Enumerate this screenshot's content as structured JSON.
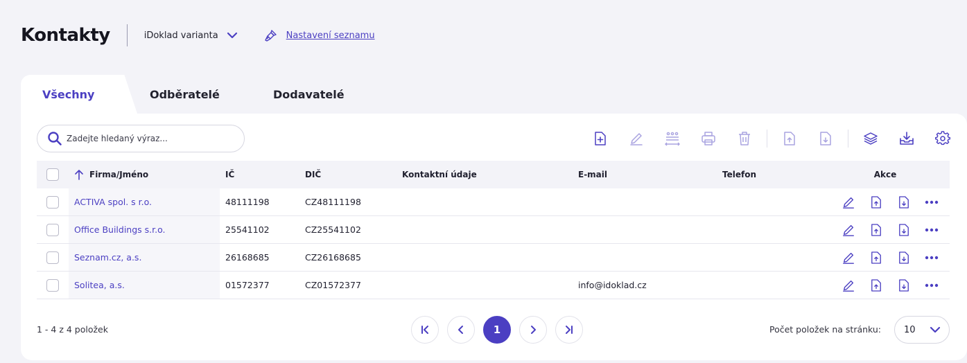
{
  "header": {
    "title": "Kontakty",
    "variant_label": "iDoklad varianta",
    "settings_link": "Nastavení seznamu"
  },
  "tabs": [
    {
      "label": "Všechny",
      "active": true
    },
    {
      "label": "Odběratelé",
      "active": false
    },
    {
      "label": "Dodavatelé",
      "active": false
    }
  ],
  "search": {
    "placeholder": "Zadejte hledaný výraz..."
  },
  "toolbar": {
    "icons": [
      "new-document-icon",
      "edit-icon",
      "bulk-action-icon",
      "print-icon",
      "delete-icon",
      "export-icon",
      "import-icon",
      "layers-icon",
      "download-icon",
      "settings-icon"
    ]
  },
  "table": {
    "columns": {
      "name": "Firma/Jméno",
      "ic": "IČ",
      "dic": "DIČ",
      "contact": "Kontaktní údaje",
      "email": "E-mail",
      "phone": "Telefon",
      "actions": "Akce"
    },
    "rows": [
      {
        "name": "ACTIVA spol. s r.o.",
        "ic": "48111198",
        "dic": "CZ48111198",
        "contact": "",
        "email": "",
        "phone": ""
      },
      {
        "name": "Office Buildings s.r.o.",
        "ic": "25541102",
        "dic": "CZ25541102",
        "contact": "",
        "email": "",
        "phone": ""
      },
      {
        "name": "Seznam.cz, a.s.",
        "ic": "26168685",
        "dic": "CZ26168685",
        "contact": "",
        "email": "",
        "phone": ""
      },
      {
        "name": "Solitea, a.s.",
        "ic": "01572377",
        "dic": "CZ01572377",
        "contact": "",
        "email": "info@idoklad.cz",
        "phone": ""
      }
    ]
  },
  "footer": {
    "count_text": "1 - 4 z 4 položek",
    "current_page": "1",
    "per_page_label": "Počet položek na stránku:",
    "per_page_value": "10"
  },
  "colors": {
    "accent": "#4b3fc2",
    "background": "#f3f3f8"
  }
}
